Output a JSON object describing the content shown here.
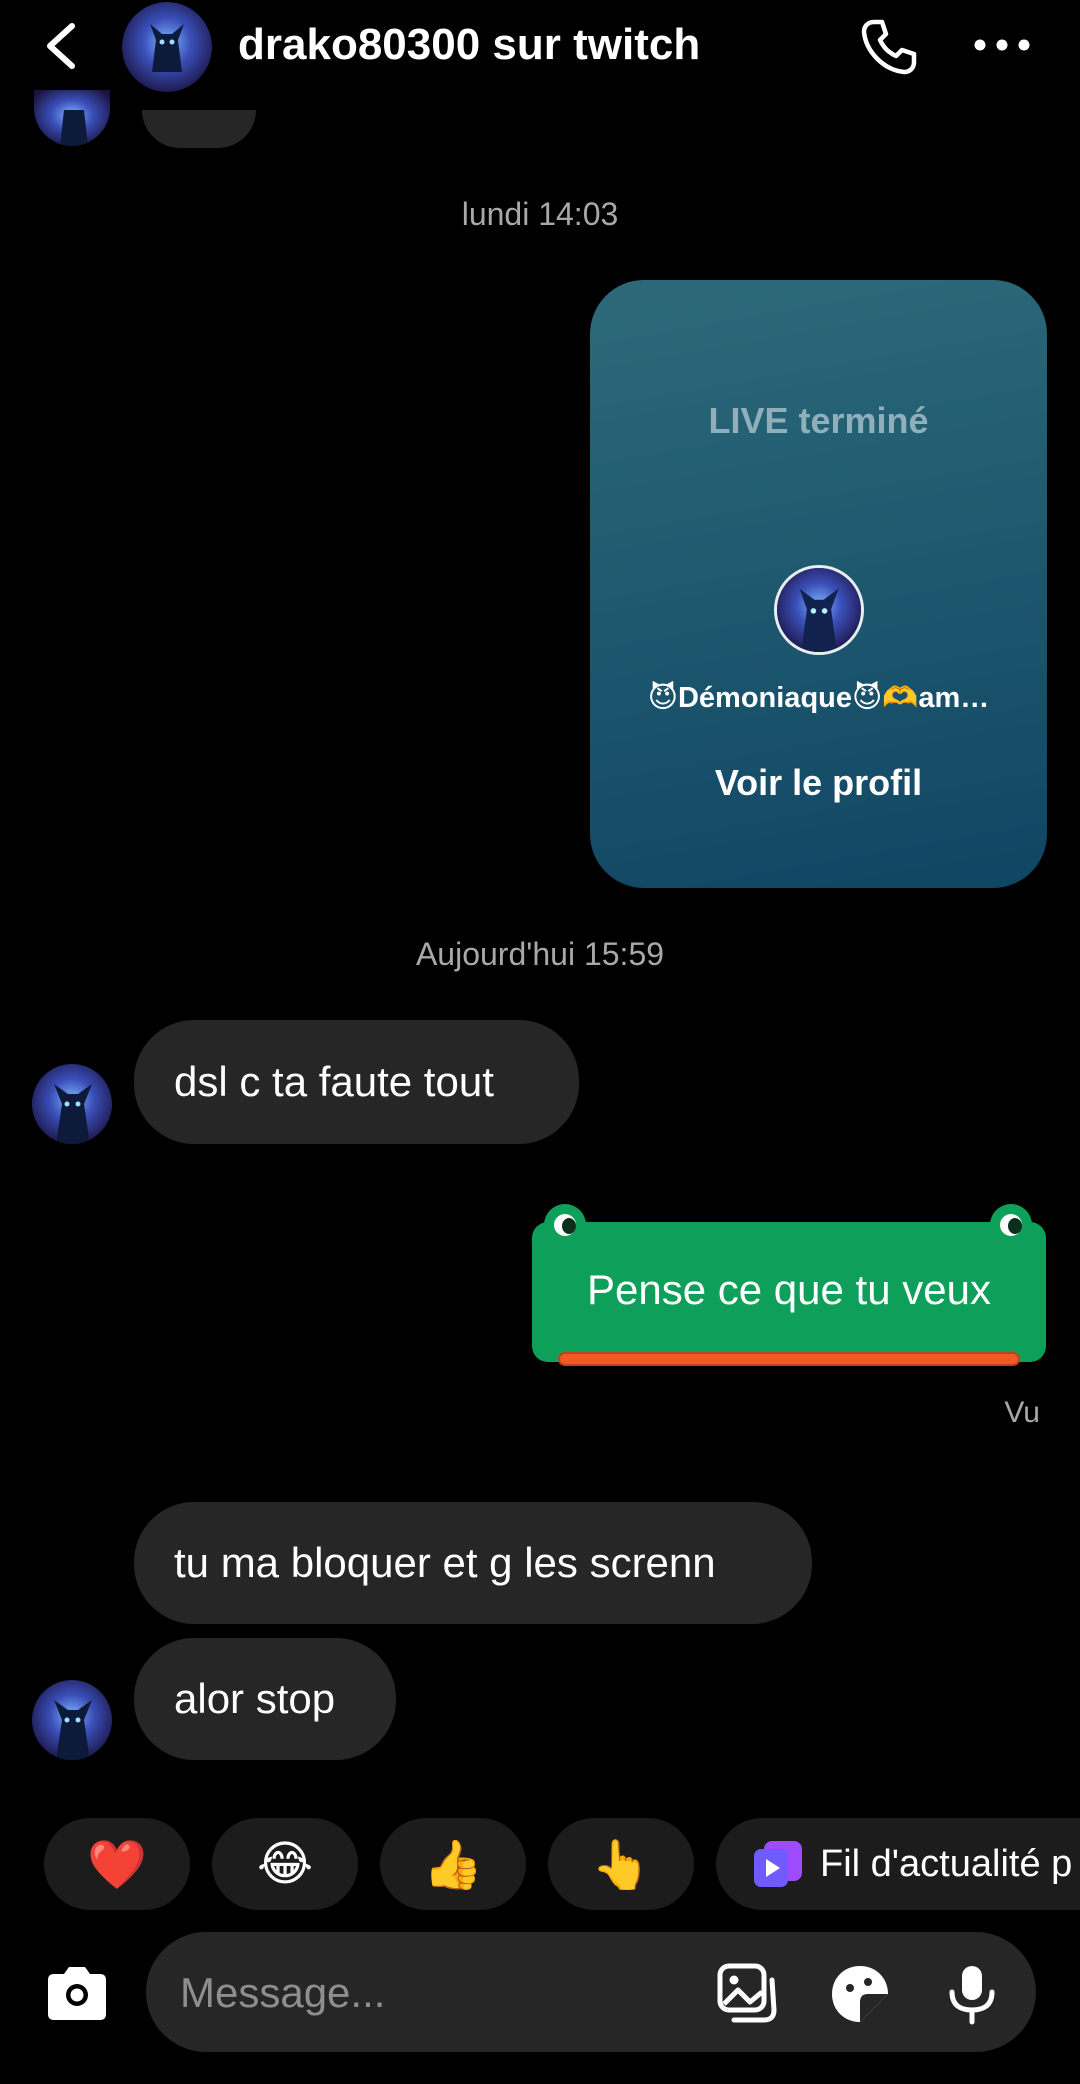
{
  "header": {
    "title": "drako80300 sur twitch",
    "back_icon": "chevron-left-icon",
    "call_icon": "phone-icon",
    "more_icon": "more-horizontal-icon"
  },
  "thread": {
    "timestamp_1": "lundi 14:03",
    "live_card": {
      "title": "LIVE terminé",
      "name": "😈Démoniaque😈🫶am…",
      "link": "Voir le profil"
    },
    "timestamp_2": "Aujourd'hui 15:59",
    "msg_1": "dsl c ta faute tout",
    "msg_sent": "Pense ce que tu veux",
    "seen": "Vu",
    "msg_2": "tu ma bloquer et g les screnn",
    "msg_3": "alor stop"
  },
  "quick_replies": {
    "heart": "❤️",
    "laugh": "😂",
    "thumbs": "👍",
    "point": "👆",
    "feed_label": "Fil d'actualité p"
  },
  "composer": {
    "placeholder": "Message..."
  },
  "colors": {
    "background": "#000000",
    "bubble_received": "#262626",
    "sticker_green": "#0ea05a",
    "sticker_orange": "#f25a23",
    "live_card_top": "#2d6a79",
    "live_card_bottom": "#104563"
  }
}
